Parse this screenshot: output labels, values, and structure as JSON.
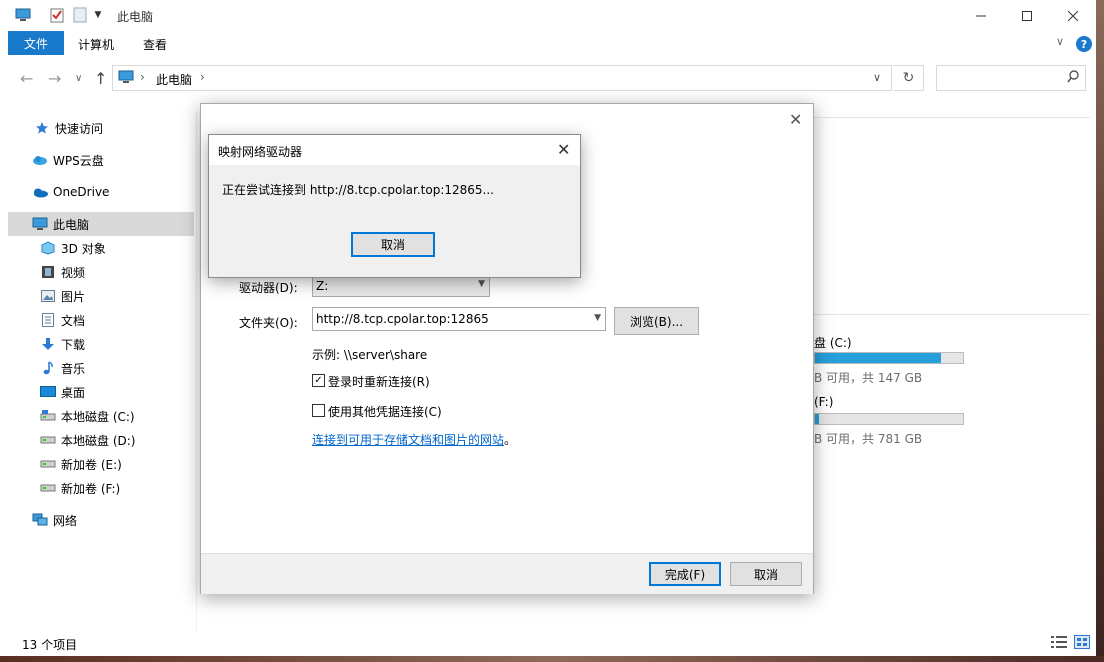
{
  "window": {
    "title": "此电脑",
    "controls": [
      "minimize-icon",
      "maximize-icon",
      "close-icon"
    ]
  },
  "ribbon": {
    "tabs": [
      "文件",
      "计算机",
      "查看"
    ],
    "help_label": "?"
  },
  "address": {
    "path": "此电脑",
    "search_placeholder": ""
  },
  "sidebar": {
    "items": [
      {
        "label": "快速访问",
        "icon": "star-icon"
      },
      {
        "label": "WPS云盘",
        "icon": "cloud-icon"
      },
      {
        "label": "OneDrive",
        "icon": "onedrive-icon"
      },
      {
        "label": "此电脑",
        "icon": "computer-icon",
        "selected": true
      },
      {
        "label": "3D 对象",
        "icon": "cube-icon"
      },
      {
        "label": "视频",
        "icon": "video-icon"
      },
      {
        "label": "图片",
        "icon": "picture-icon"
      },
      {
        "label": "文档",
        "icon": "document-icon"
      },
      {
        "label": "下载",
        "icon": "download-icon"
      },
      {
        "label": "音乐",
        "icon": "music-icon"
      },
      {
        "label": "桌面",
        "icon": "desktop-icon"
      },
      {
        "label": "本地磁盘 (C:)",
        "icon": "drive-icon"
      },
      {
        "label": "本地磁盘 (D:)",
        "icon": "drive-icon"
      },
      {
        "label": "新加卷 (E:)",
        "icon": "drive-icon"
      },
      {
        "label": "新加卷 (F:)",
        "icon": "drive-icon"
      },
      {
        "label": "网络",
        "icon": "network-icon"
      }
    ]
  },
  "drives": [
    {
      "label": "盘 (C:)",
      "sub": "B 可用，共 147 GB",
      "used_fraction": 0.85
    },
    {
      "label": "(F:)",
      "sub": "B 可用，共 781 GB",
      "used_fraction": 0.03
    }
  ],
  "status": {
    "item_count": "13 个项目"
  },
  "wizard": {
    "drive_label": "驱动器(D):",
    "drive_value": "Z:",
    "folder_label": "文件夹(O):",
    "folder_value": "http://8.tcp.cpolar.top:12865",
    "browse_label": "浏览(B)...",
    "example": "示例: \\\\server\\share",
    "reconnect_label": "登录时重新连接(R)",
    "reconnect_checked": "✓",
    "credentials_label": "使用其他凭据连接(C)",
    "link_text": "连接到可用于存储文档和图片的网站",
    "link_suffix": "。",
    "finish_label": "完成(F)",
    "cancel_label": "取消"
  },
  "progress_dialog": {
    "title": "映射网络驱动器",
    "message": "正在尝试连接到 http://8.tcp.cpolar.top:12865...",
    "cancel_label": "取消"
  }
}
